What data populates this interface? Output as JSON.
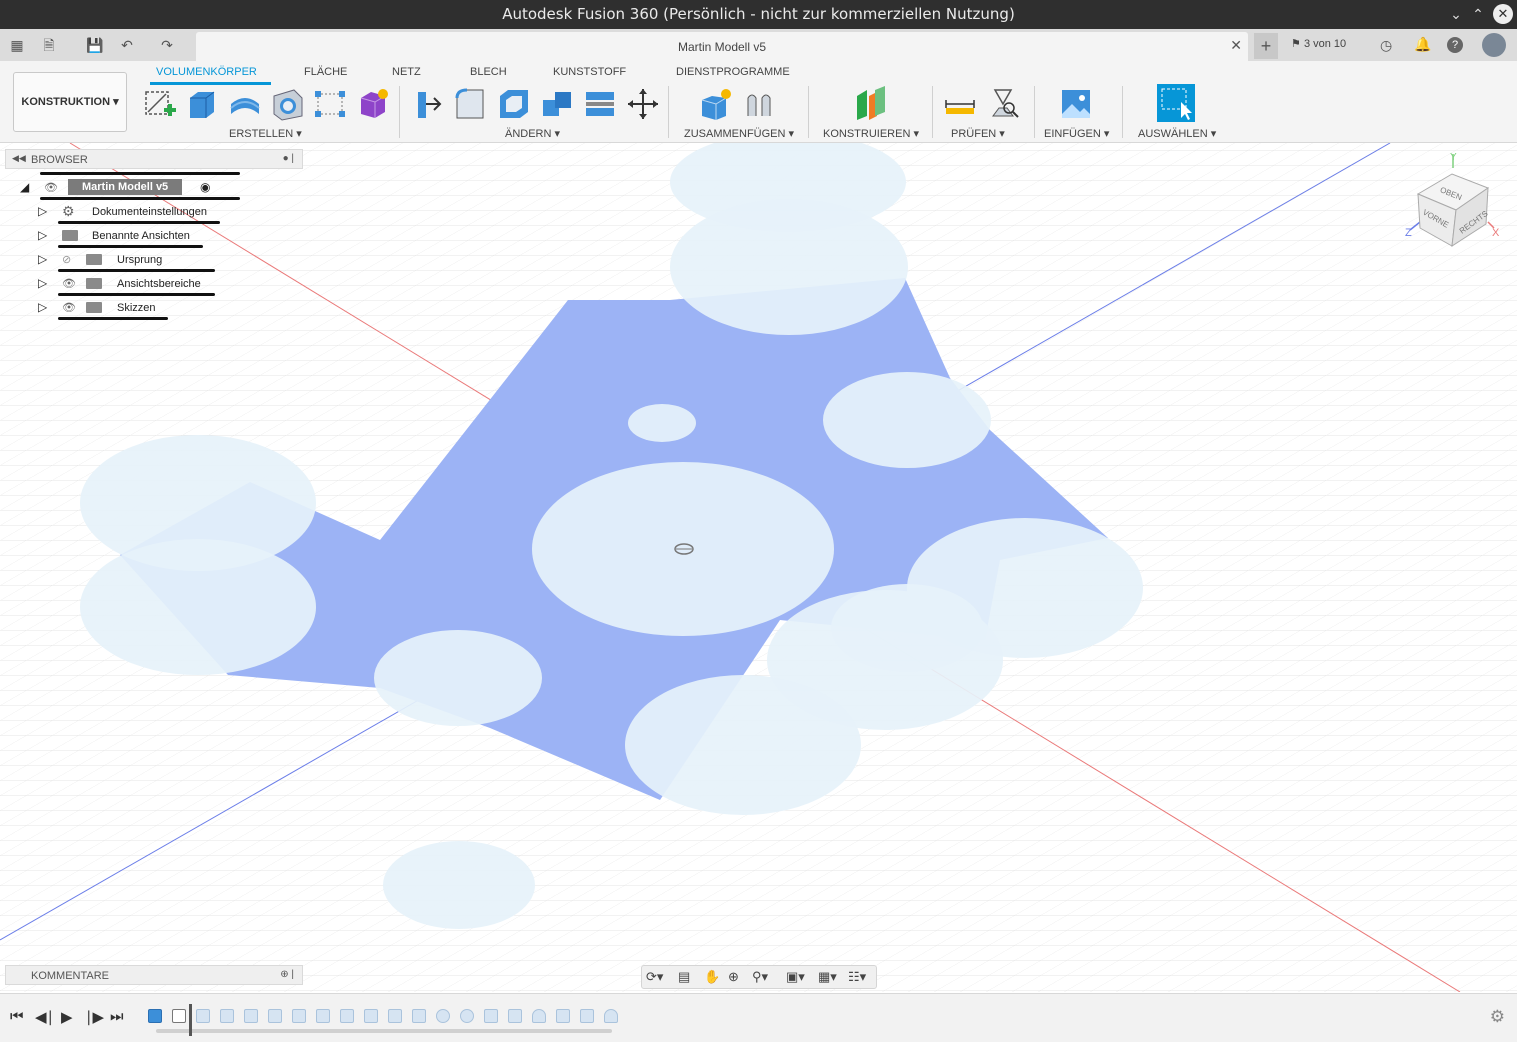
{
  "window": {
    "title": "Autodesk Fusion 360 (Persönlich - nicht zur kommerziellen Nutzung)"
  },
  "document": {
    "tab_title": "Martin Modell v5",
    "jobs": "3 von 10"
  },
  "ribbon": {
    "workspace": "KONSTRUKTION",
    "tabs": [
      "VOLUMENKÖRPER",
      "FLÄCHE",
      "NETZ",
      "BLECH",
      "KUNSTSTOFF",
      "DIENSTPROGRAMME"
    ],
    "active_tab": "VOLUMENKÖRPER",
    "groups": {
      "create": "ERSTELLEN",
      "modify": "ÄNDERN",
      "assemble": "ZUSAMMENFÜGEN",
      "construct": "KONSTRUIEREN",
      "inspect": "PRÜFEN",
      "insert": "EINFÜGEN",
      "select": "AUSWÄHLEN"
    }
  },
  "browser": {
    "title": "BROWSER",
    "root": "Martin Modell v5",
    "items": [
      {
        "label": "Dokumenteinstellungen",
        "icon": "gear-icon"
      },
      {
        "label": "Benannte Ansichten",
        "icon": "folder-icon"
      },
      {
        "label": "Ursprung",
        "icon": "folder-icon",
        "hidden": true
      },
      {
        "label": "Ansichtsbereiche",
        "icon": "folder-icon"
      },
      {
        "label": "Skizzen",
        "icon": "folder-icon"
      }
    ]
  },
  "comments": {
    "title": "KOMMENTARE"
  },
  "viewcube": {
    "top": "OBEN",
    "front": "VORNE",
    "right": "RECHTS",
    "axis_x": "X",
    "axis_y": "Y",
    "axis_z": "Z"
  },
  "colors": {
    "accent": "#0696d7",
    "profile_fill": "#9cb3f5",
    "circle_fill": "#e6f2fa",
    "titlebar": "#2f2f2f"
  }
}
